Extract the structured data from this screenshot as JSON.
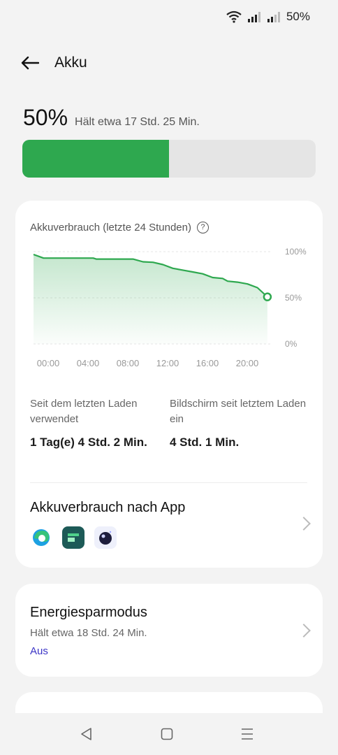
{
  "status": {
    "battery_percent": "50%",
    "icons": [
      "wifi-icon",
      "signal-icon",
      "signal-icon"
    ]
  },
  "header": {
    "title": "Akku",
    "back_icon": "arrow-left-icon"
  },
  "battery": {
    "percent_label": "50%",
    "remaining_text": "Hält etwa 17 Std. 25 Min.",
    "level": 0.5,
    "colors": {
      "fill": "#2ea84f",
      "track": "#e5e5e5"
    }
  },
  "usage_card": {
    "title": "Akkuverbrauch (letzte 24 Stunden)",
    "stats": [
      {
        "label": "Seit dem letzten Laden verwendet",
        "value": "1 Tag(e) 4 Std. 2 Min."
      },
      {
        "label": "Bildschirm seit letztem Laden ein",
        "value": "4 Std. 1 Min."
      }
    ],
    "apps_title": "Akkuverbrauch nach App",
    "app_icons": [
      "edge-icon",
      "app-green-icon",
      "app-moon-icon"
    ]
  },
  "chart_data": {
    "type": "area",
    "x_ticks": [
      "00:00",
      "04:00",
      "08:00",
      "12:00",
      "16:00",
      "20:00"
    ],
    "y_ticks": [
      "100%",
      "50%",
      "0%"
    ],
    "ylim": [
      0,
      100
    ],
    "xlim": [
      0,
      24
    ],
    "points": [
      [
        0,
        97
      ],
      [
        1,
        93
      ],
      [
        2,
        93
      ],
      [
        4,
        93
      ],
      [
        6,
        93
      ],
      [
        6.3,
        92
      ],
      [
        8,
        92
      ],
      [
        10,
        92
      ],
      [
        11,
        89
      ],
      [
        12,
        88.5
      ],
      [
        13,
        86
      ],
      [
        14,
        82
      ],
      [
        15,
        80
      ],
      [
        16,
        78
      ],
      [
        17,
        76
      ],
      [
        18,
        72
      ],
      [
        19,
        71
      ],
      [
        19.5,
        68
      ],
      [
        20.5,
        67
      ],
      [
        21.5,
        65
      ],
      [
        22.5,
        61
      ],
      [
        23.5,
        51
      ]
    ],
    "color": "#2ea84f",
    "grid": true
  },
  "power_saving": {
    "title": "Energiesparmodus",
    "subtitle": "Hält etwa 18 Std. 24 Min.",
    "status": "Aus",
    "status_color": "#3b34c6"
  },
  "nav": {
    "icons": [
      "back-triangle-icon",
      "home-square-icon",
      "menu-lines-icon"
    ]
  }
}
